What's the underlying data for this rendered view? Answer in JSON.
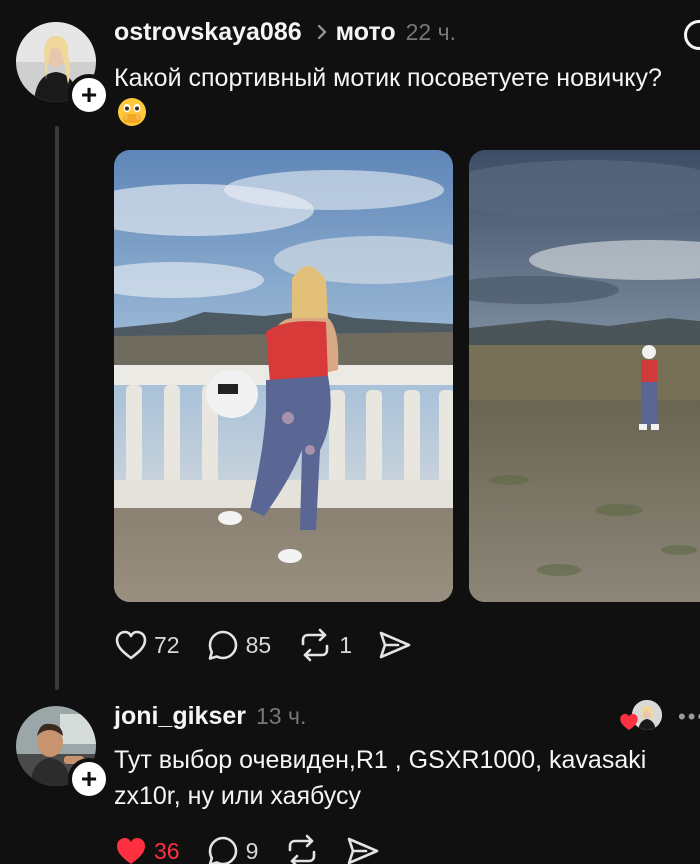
{
  "post": {
    "username": "ostrovskaya086",
    "topic": "мото",
    "time": "22 ч.",
    "text": "Какой спортивный мотик посоветуете новичку?",
    "emoji_icon": "face-with-hand-over-mouth-emoji",
    "avatar_icon": "avatar-photo",
    "plus_label": "+",
    "photos": [
      {
        "icon": "photo-woman-at-balustrade"
      },
      {
        "icon": "photo-woman-on-plateau"
      }
    ],
    "actions": {
      "likes": "72",
      "comments": "85",
      "reposts": "1"
    }
  },
  "reply": {
    "username": "joni_gikser",
    "time": "13 ч.",
    "text": "Тут выбор очевиден,R1 , GSXR1000, kavasaki zx10r, ну или хаябусу",
    "avatar_icon": "avatar-photo",
    "plus_label": "+",
    "liked_by_author_icon": "heart-with-avatar-icon",
    "actions": {
      "likes": "36",
      "comments": "9"
    }
  },
  "colors": {
    "background": "#101010",
    "text": "#f3f5f7",
    "muted": "#777777",
    "like_active": "#ff3040"
  }
}
